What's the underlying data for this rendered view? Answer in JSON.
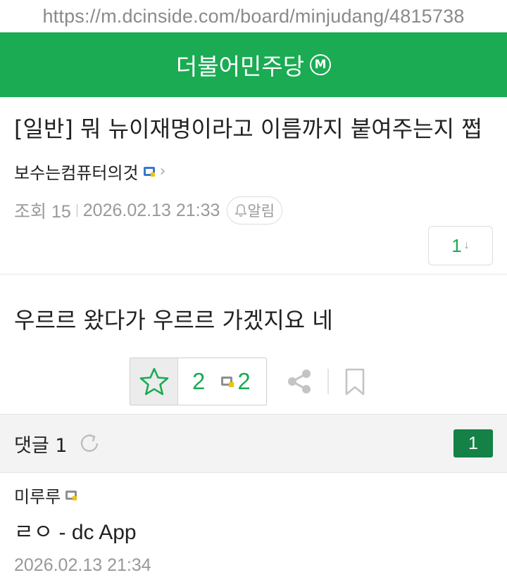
{
  "browser": {
    "url": "https://m.dcinside.com/board/minjudang/4815738"
  },
  "gallery": {
    "name": "더불어민주당",
    "badge": "M"
  },
  "post": {
    "title": "[일반] 뭐 뉴이재명이라고 이름까지 붙여주는지 쩝",
    "author": "보수는컴퓨터의것",
    "views_label": "조회 15",
    "datetime": "2026.02.13 21:33",
    "alarm_label": "알림",
    "comment_jump_count": "1",
    "comment_jump_arrow": "↓",
    "body": "우르르 왔다가 우르르 가겠지요 네",
    "recommend_count": "2",
    "fixed_recommend_count": "2"
  },
  "comments": {
    "label": "댓글 1",
    "count_badge": "1",
    "items": [
      {
        "author": "미루루",
        "text": "ㄹㅇ - dc App",
        "datetime": "2026.02.13 21:34"
      }
    ]
  },
  "colors": {
    "brand": "#1aab53",
    "badge": "#148146",
    "muted": "#999999"
  },
  "icons": [
    "author-fixed-icon",
    "chevron-right-icon",
    "bell-icon",
    "star-icon",
    "share-icon",
    "bookmark-icon",
    "refresh-icon"
  ]
}
